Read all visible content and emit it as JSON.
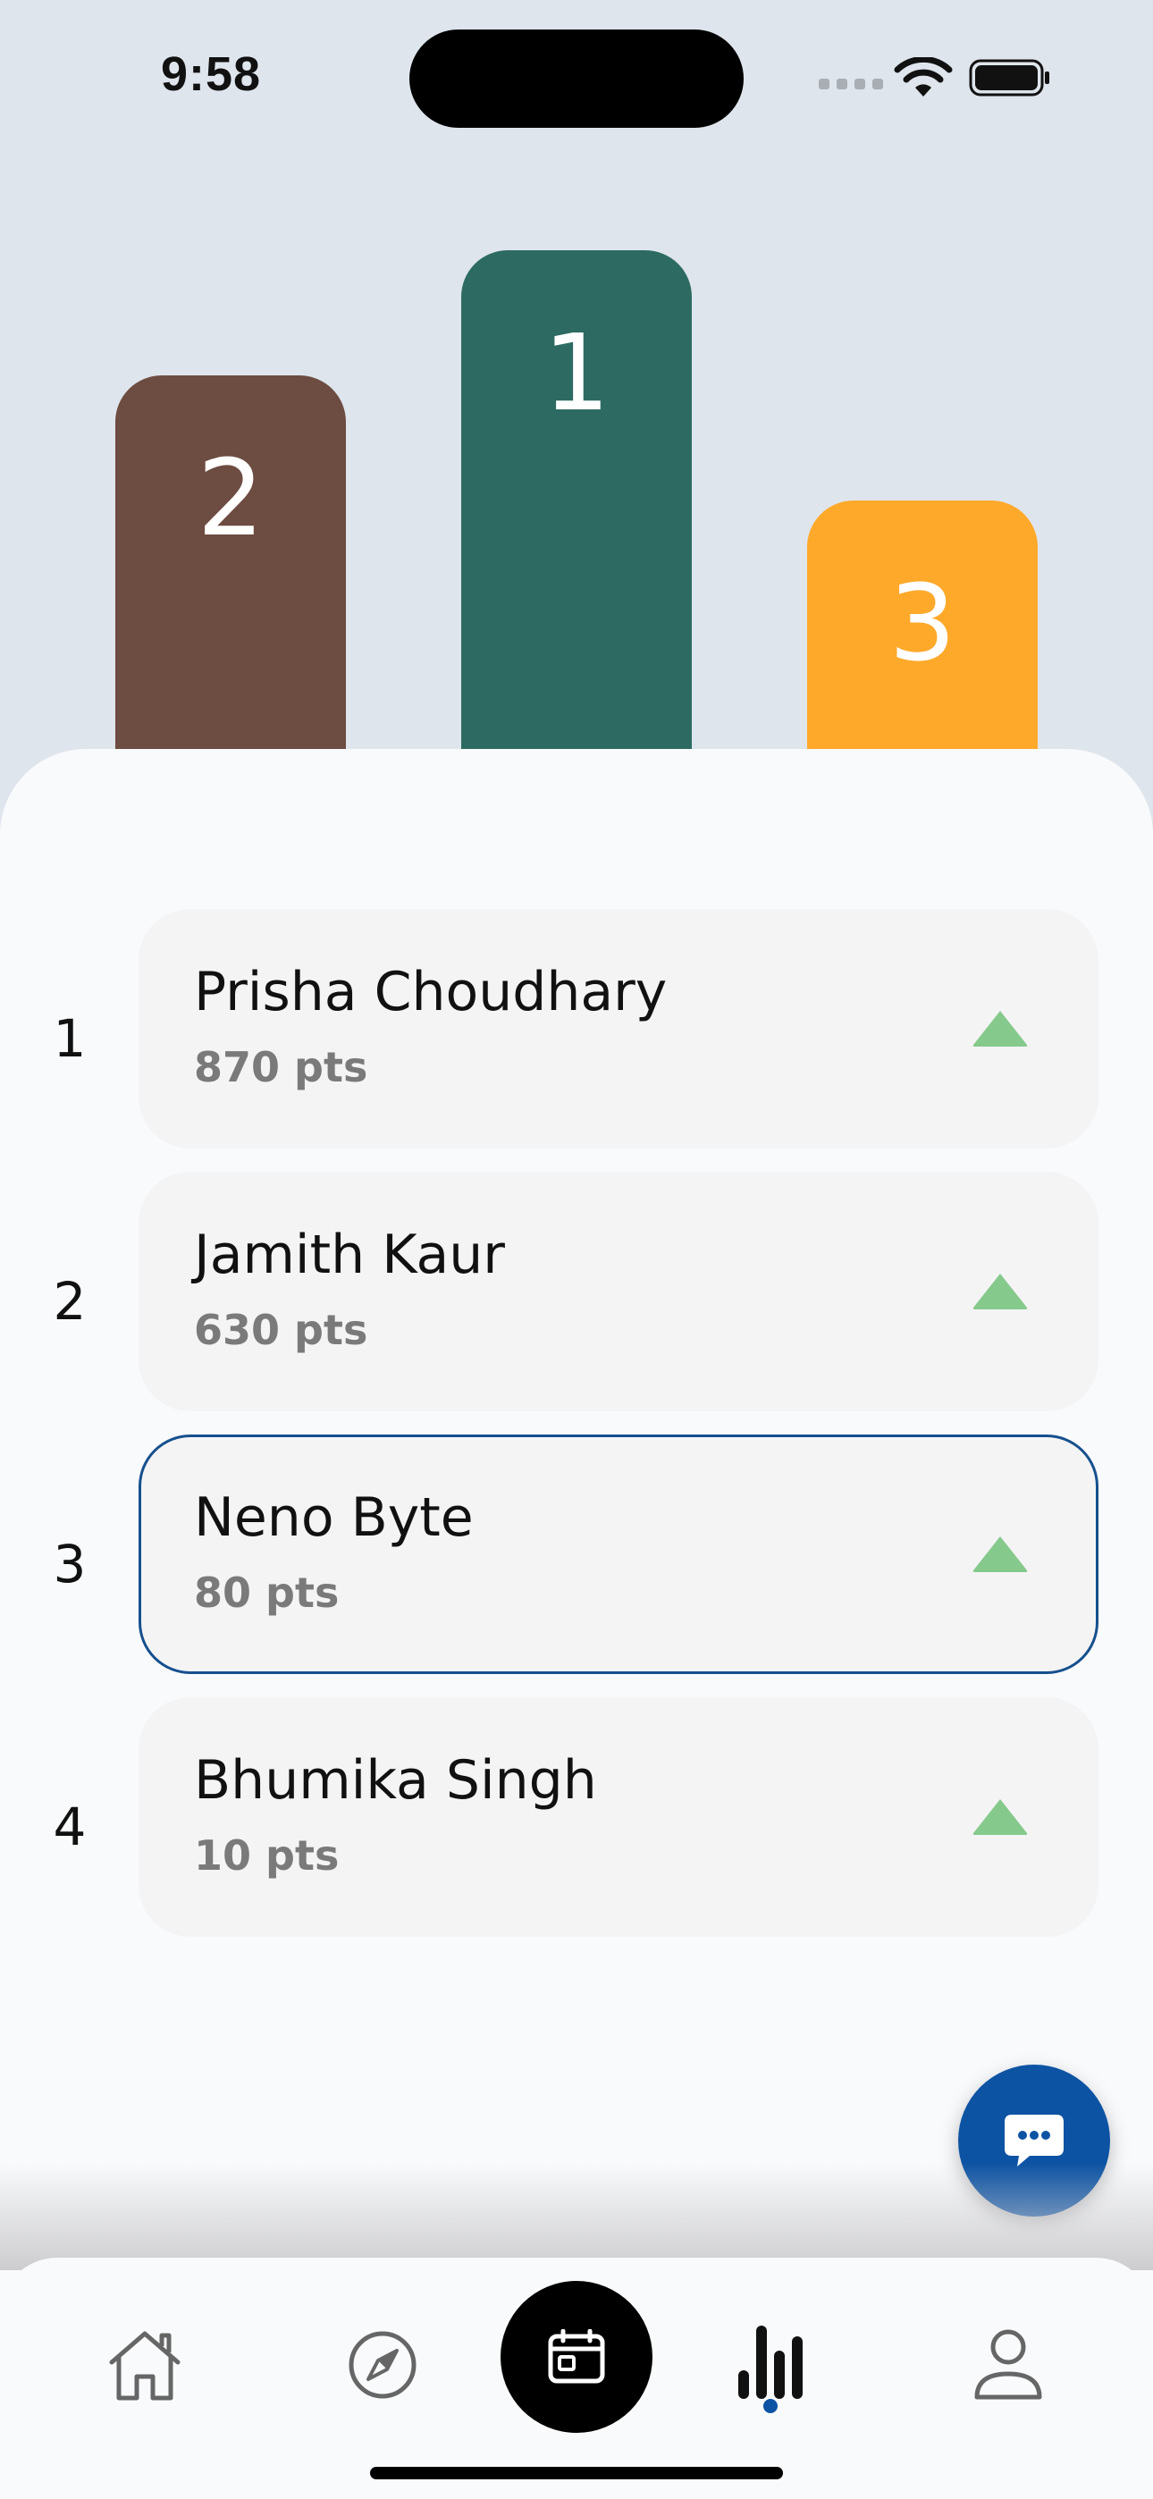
{
  "status_bar": {
    "time": "9:58"
  },
  "podium": [
    {
      "rank": "2"
    },
    {
      "rank": "1"
    },
    {
      "rank": "3"
    }
  ],
  "leaderboard": [
    {
      "rank": "1",
      "name": "Prisha Choudhary",
      "points": "870 pts",
      "trend": "up-arrow-icon"
    },
    {
      "rank": "2",
      "name": "Jamith Kaur",
      "points": "630 pts",
      "trend": "up-arrow-icon"
    },
    {
      "rank": "3",
      "name": "Neno Byte",
      "points": "80 pts",
      "trend": "up-arrow-icon",
      "current_user": true
    },
    {
      "rank": "4",
      "name": "Bhumika Singh",
      "points": "10 pts",
      "trend": "up-arrow-icon"
    }
  ],
  "nav": {
    "items": [
      "home-icon",
      "compass-icon",
      "calendar-icon",
      "leaderboard-icon",
      "profile-icon"
    ],
    "active": "leaderboard-icon"
  },
  "colors": {
    "podium_first": "#2d6b62",
    "podium_second": "#6d4c41",
    "podium_third": "#ffa92b",
    "accent": "#0d53a3",
    "trend_up": "#86c98c"
  }
}
